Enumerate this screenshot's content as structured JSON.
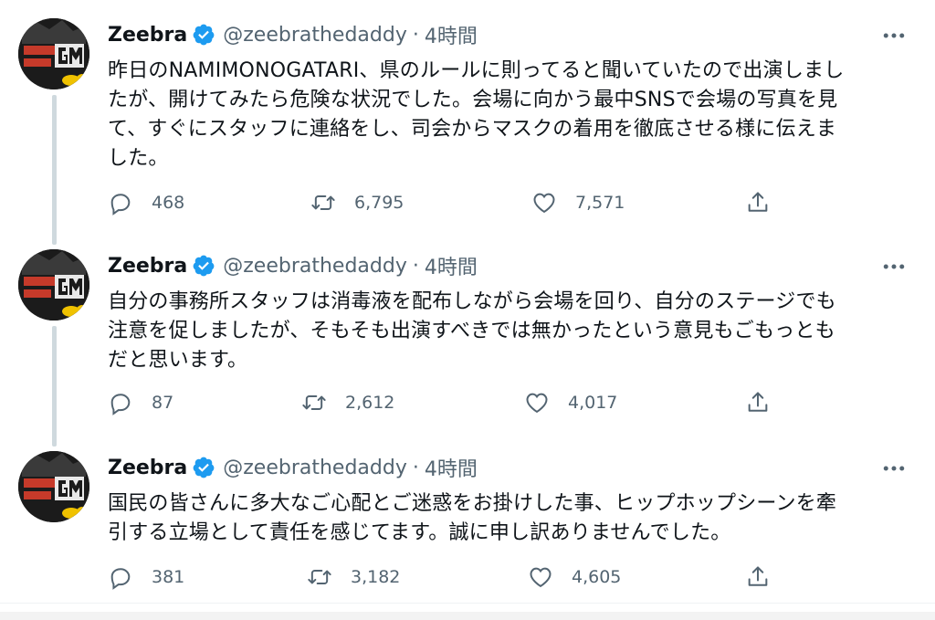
{
  "tweets": [
    {
      "name": "Zeebra",
      "handle": "@zeebrathedaddy",
      "separator": "·",
      "time": "4時間",
      "lines": [
        "昨日のNAMIMONOGATARI、県のルールに則ってると聞いていたので出演しまし",
        "たが、開けてみたら危険な状況でした。会場に向かう最中SNSで会場の写真を見",
        "て、すぐにスタッフに連絡をし、司会からマスクの着用を徹底させる様に伝えま",
        "した。"
      ],
      "replies": "468",
      "retweets": "6,795",
      "likes": "7,571"
    },
    {
      "name": "Zeebra",
      "handle": "@zeebrathedaddy",
      "separator": "·",
      "time": "4時間",
      "lines": [
        "自分の事務所スタッフは消毒液を配布しながら会場を回り、自分のステージでも",
        "注意を促しましたが、そもそも出演すべきでは無かったという意見もごもっとも",
        "だと思います。"
      ],
      "replies": "87",
      "retweets": "2,612",
      "likes": "4,017"
    },
    {
      "name": "Zeebra",
      "handle": "@zeebrathedaddy",
      "separator": "·",
      "time": "4時間",
      "lines": [
        "国民の皆さんに多大なご心配とご迷惑をお掛けした事、ヒップホップシーンを牽",
        "引する立場として責任を感じてます。誠に申し訳ありませんでした。"
      ],
      "replies": "381",
      "retweets": "3,182",
      "likes": "4,605"
    }
  ],
  "icons": {
    "verified": "verified-badge-icon",
    "more": "more-icon",
    "reply": "reply-icon",
    "retweet": "retweet-icon",
    "like": "like-icon",
    "share": "share-icon"
  },
  "colors": {
    "text": "#0f1419",
    "secondary": "#536471",
    "verified": "#1d9bf0",
    "thread_line": "#cfd9de"
  }
}
